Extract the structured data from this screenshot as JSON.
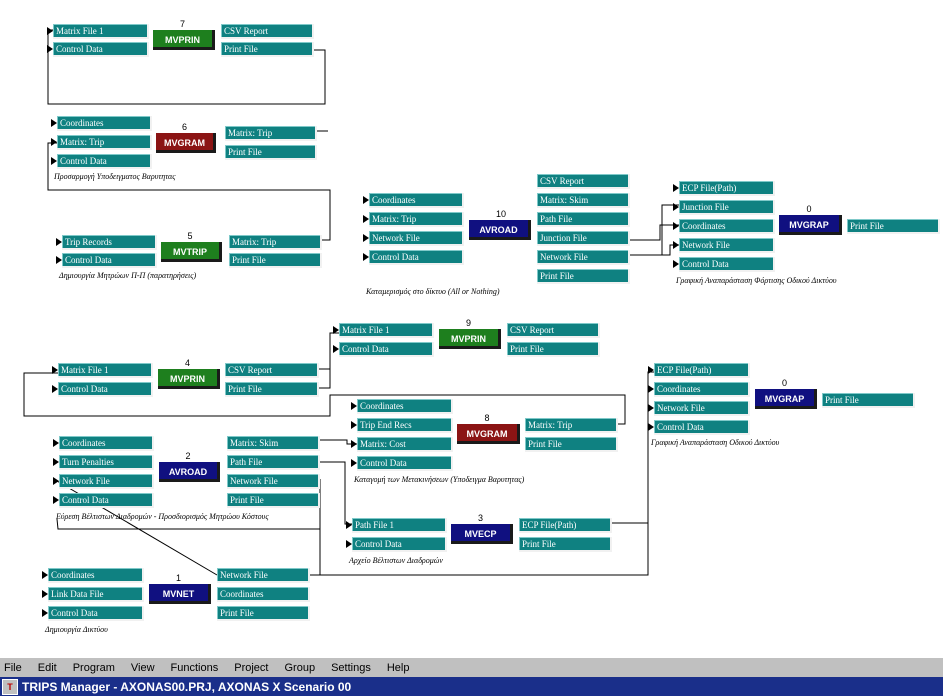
{
  "window": {
    "title": "TRIPS Manager - AXONAS00.PRJ, AXONAS X Scenario 00"
  },
  "menu": [
    "File",
    "Edit",
    "Program",
    "View",
    "Functions",
    "Project",
    "Group",
    "Settings",
    "Help"
  ],
  "colors": {
    "file_box": "#0f8181",
    "green_program": "#1e7f1e",
    "red_program": "#8b1414",
    "blue_program": "#101080",
    "title_bar": "#1a2f8a"
  },
  "blocks": [
    {
      "id": "b1",
      "program": "MVPRIN",
      "color": "green",
      "number": "7",
      "caption": "",
      "inputs": [
        "Matrix File 1",
        "Control Data"
      ],
      "outputs": [
        "CSV Report",
        "Print File"
      ]
    },
    {
      "id": "b2",
      "program": "MVGRAM",
      "color": "red",
      "number": "6",
      "caption": "Προσαρμογή Υποδειγματος Βαρυτητας",
      "inputs": [
        "Coordinates",
        "Matrix: Trip",
        "Control Data"
      ],
      "outputs": [
        "Matrix: Trip",
        "Print File"
      ]
    },
    {
      "id": "b3",
      "program": "MVTRIP",
      "color": "green",
      "number": "5",
      "caption": "Δημιουργία Μητρώων Π-Π (παρατηρήσεις)",
      "inputs": [
        "Trip Records",
        "Control Data"
      ],
      "outputs": [
        "Matrix: Trip",
        "Print File"
      ]
    },
    {
      "id": "b4",
      "program": "AVROAD",
      "color": "blue",
      "number": "10",
      "caption": "Καταμερισμός στο δίκτυο (All or Nothing)",
      "inputs": [
        "Coordinates",
        "Matrix: Trip",
        "Network File",
        "Control Data"
      ],
      "outputs": [
        "CSV Report",
        "Matrix: Skim",
        "Path File",
        "Junction File",
        "Network File",
        "Print File"
      ]
    },
    {
      "id": "b5",
      "program": "MVGRAP",
      "color": "blue",
      "number": "0",
      "caption": "Γραφική Αναπαράσταση Φόρτισης Οδικού Δικτύου",
      "inputs": [
        "ECP File(Path)",
        "Junction File",
        "Coordinates",
        "Network File",
        "Control Data"
      ],
      "outputs": [
        "Print File"
      ]
    },
    {
      "id": "b6",
      "program": "MVPRIN",
      "color": "green",
      "number": "9",
      "caption": "",
      "inputs": [
        "Matrix File 1",
        "Control Data"
      ],
      "outputs": [
        "CSV Report",
        "Print File"
      ]
    },
    {
      "id": "b7",
      "program": "MVPRIN",
      "color": "green",
      "number": "4",
      "caption": "",
      "inputs": [
        "Matrix File 1",
        "Control Data"
      ],
      "outputs": [
        "CSV Report",
        "Print File"
      ]
    },
    {
      "id": "b8",
      "program": "MVGRAP",
      "color": "blue",
      "number": "0",
      "caption": "Γραφική Αναπαράσταση Οδικού Δικτύου",
      "inputs": [
        "ECP File(Path)",
        "Coordinates",
        "Network File",
        "Control Data"
      ],
      "outputs": [
        "Print File"
      ]
    },
    {
      "id": "b9",
      "program": "MVGRAM",
      "color": "red",
      "number": "8",
      "caption": "Καταγομή των Μετακινήσεων (Υποδειγμα Βαρυτητας)",
      "inputs": [
        "Coordinates",
        "Trip End Recs",
        "Matrix: Cost",
        "Control Data"
      ],
      "outputs": [
        "Matrix: Trip",
        "Print File"
      ]
    },
    {
      "id": "b10",
      "program": "AVROAD",
      "color": "blue",
      "number": "2",
      "caption": "Εύρεση Βέλτιστων Διαδρομών - Προσδιορισμός Μητρώου Κόστους",
      "inputs": [
        "Coordinates",
        "Turn Penalties",
        "Network File",
        "Control Data"
      ],
      "outputs": [
        "Matrix: Skim",
        "Path File",
        "Network File",
        "Print File"
      ]
    },
    {
      "id": "b11",
      "program": "MVECP",
      "color": "blue",
      "number": "3",
      "caption": "Αρχείο Βέλτιστων Διαδρομών",
      "inputs": [
        "Path File 1",
        "Control Data"
      ],
      "outputs": [
        "ECP File(Path)",
        "Print File"
      ]
    },
    {
      "id": "b12",
      "program": "MVNET",
      "color": "blue",
      "number": "1",
      "caption": "Δημιουργία Δικτύου",
      "inputs": [
        "Coordinates",
        "Link Data File",
        "Control Data"
      ],
      "outputs": [
        "Network File",
        "Coordinates",
        "Print File"
      ]
    }
  ]
}
